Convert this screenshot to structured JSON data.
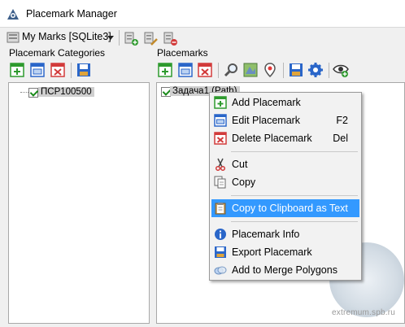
{
  "window": {
    "title": "Placemark Manager"
  },
  "db": {
    "selected": "My Marks [SQLite3]"
  },
  "categories": {
    "label": "Placemark Categories",
    "items": [
      {
        "label": "ПСР100500",
        "checked": true
      }
    ]
  },
  "placemarks": {
    "label": "Placemarks",
    "items": [
      {
        "label": "Задача1 (Path)",
        "checked": true
      }
    ]
  },
  "context_menu": {
    "items": [
      {
        "label": "Add Placemark",
        "shortcut": "",
        "icon": "add-placemark-icon"
      },
      {
        "label": "Edit Placemark",
        "shortcut": "F2",
        "icon": "edit-placemark-icon"
      },
      {
        "label": "Delete Placemark",
        "shortcut": "Del",
        "icon": "delete-placemark-icon"
      },
      {
        "label": "Cut",
        "shortcut": "",
        "icon": "scissors-icon"
      },
      {
        "label": "Copy",
        "shortcut": "",
        "icon": "copy-icon"
      },
      {
        "label": "Copy to Clipboard as Text",
        "shortcut": "",
        "icon": "clipboard-icon"
      },
      {
        "label": "Placemark Info",
        "shortcut": "",
        "icon": "info-icon"
      },
      {
        "label": "Export Placemark",
        "shortcut": "",
        "icon": "export-icon"
      },
      {
        "label": "Add to Merge Polygons",
        "shortcut": "",
        "icon": "merge-polygons-icon"
      }
    ]
  },
  "watermark": {
    "text": "extremum.spb.ru"
  },
  "colors": {
    "highlight": "#3399ff",
    "accent_green": "#2e9a2e",
    "accent_red": "#d23b3b",
    "accent_blue": "#2a66c9"
  }
}
